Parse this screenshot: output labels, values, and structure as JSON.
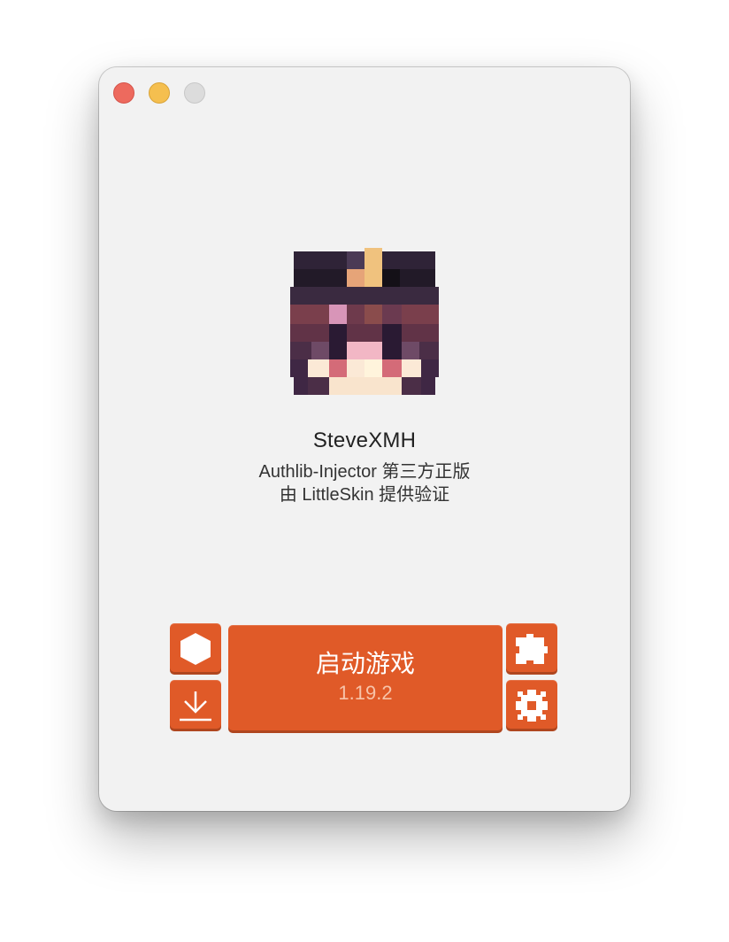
{
  "window": {
    "controls": [
      "close",
      "minimize",
      "zoom"
    ]
  },
  "profile": {
    "username": "SteveXMH",
    "auth_type": "Authlib-Injector 第三方正版",
    "auth_provider": "由 LittleSkin 提供验证"
  },
  "actions": {
    "launch_label": "启动游戏",
    "version": "1.19.2",
    "left_buttons": [
      "version-cube-icon",
      "download-icon"
    ],
    "right_buttons": [
      "puzzle-icon",
      "gear-icon"
    ]
  },
  "colors": {
    "accent": "#e05a28",
    "window_bg": "#f2f2f2"
  }
}
